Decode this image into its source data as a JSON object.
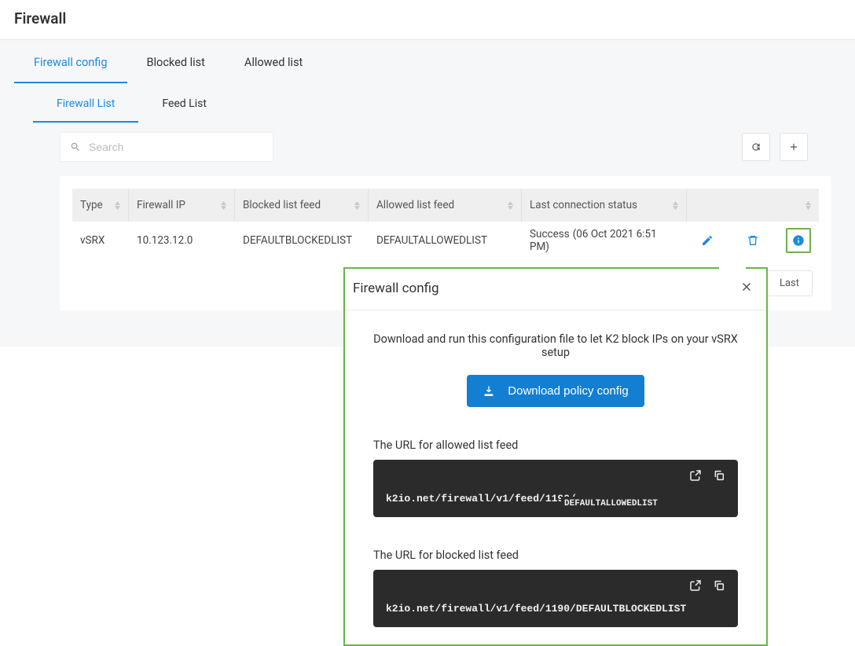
{
  "page_title": "Firewall",
  "tabs": {
    "config": "Firewall config",
    "blocked": "Blocked list",
    "allowed": "Allowed list"
  },
  "subtabs": {
    "firewall_list": "Firewall List",
    "feed_list": "Feed List"
  },
  "search": {
    "placeholder": "Search"
  },
  "columns": {
    "type": "Type",
    "ip": "Firewall IP",
    "blocked_feed": "Blocked list feed",
    "allowed_feed": "Allowed list feed",
    "status": "Last connection status"
  },
  "row": {
    "type": "vSRX",
    "ip": "10.123.12.0",
    "blocked_feed": "DEFAULTBLOCKEDLIST",
    "allowed_feed": "DEFAULTALLOWEDLIST",
    "status": "Success",
    "status_ts": "(06 Oct 2021 6:51 PM)"
  },
  "pager": {
    "last": "Last"
  },
  "popover": {
    "title": "Firewall config",
    "desc": "Download and run this configuration file to let K2 block IPs on your vSRX setup",
    "download_label": "Download policy config",
    "allowed_label": "The URL for allowed list feed",
    "allowed_url": "k2io.net/firewall/v1/feed/1190/",
    "allowed_overlay": "DEFAULTALLOWEDLIST",
    "blocked_label": "The URL for blocked list feed",
    "blocked_url": "k2io.net/firewall/v1/feed/1190/DEFAULTBLOCKEDLIST"
  },
  "colors": {
    "accent_blue": "#1b8ae6",
    "button_blue": "#127fd2",
    "highlight_green": "#6bb34b"
  }
}
